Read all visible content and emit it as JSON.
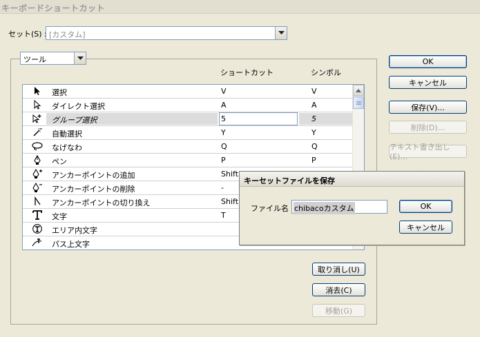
{
  "window": {
    "title": "キーボードショートカット"
  },
  "set": {
    "label": "セット(S) :",
    "value": "[カスタム]"
  },
  "tool_select": {
    "value": "ツール"
  },
  "columns": {
    "shortcut": "ショートカット",
    "symbol": "シンボル"
  },
  "rows": [
    {
      "icon": "selection-arrow-icon",
      "name": "選択",
      "shortcut": "V",
      "symbol": "V"
    },
    {
      "icon": "direct-selection-icon",
      "name": "ダイレクト選択",
      "shortcut": "A",
      "symbol": "A"
    },
    {
      "icon": "group-selection-icon",
      "name": "グループ選択",
      "shortcut": "5",
      "symbol": "5",
      "selected": true
    },
    {
      "icon": "magic-wand-icon",
      "name": "自動選択",
      "shortcut": "Y",
      "symbol": "Y"
    },
    {
      "icon": "lasso-icon",
      "name": "なげなわ",
      "shortcut": "Q",
      "symbol": "Q"
    },
    {
      "icon": "pen-icon",
      "name": "ペン",
      "shortcut": "P",
      "symbol": "P"
    },
    {
      "icon": "add-anchor-icon",
      "name": "アンカーポイントの追加",
      "shortcut": "Shift+",
      "symbol": ""
    },
    {
      "icon": "delete-anchor-icon",
      "name": "アンカーポイントの削除",
      "shortcut": "-",
      "symbol": ""
    },
    {
      "icon": "convert-anchor-icon",
      "name": "アンカーポイントの切り換え",
      "shortcut": "Shift+",
      "symbol": ""
    },
    {
      "icon": "type-icon",
      "name": "文字",
      "shortcut": "T",
      "symbol": ""
    },
    {
      "icon": "area-type-icon",
      "name": "エリア内文字",
      "shortcut": "",
      "symbol": ""
    },
    {
      "icon": "path-type-icon",
      "name": "パス上文字",
      "shortcut": "",
      "symbol": ""
    }
  ],
  "buttons": {
    "ok": "OK",
    "cancel": "キャンセル",
    "save": "保存(V)...",
    "delete": "削除(D)...",
    "export_text": "テキスト書き出し(E)...",
    "undo": "取り消し(U)",
    "clear": "消去(C)",
    "move": "移動(G)"
  },
  "dialog": {
    "title": "キーセットファイルを保存",
    "file_label": "ファイル名 :",
    "file_value": "chibacoカスタム",
    "ok": "OK",
    "cancel": "キャンセル"
  }
}
